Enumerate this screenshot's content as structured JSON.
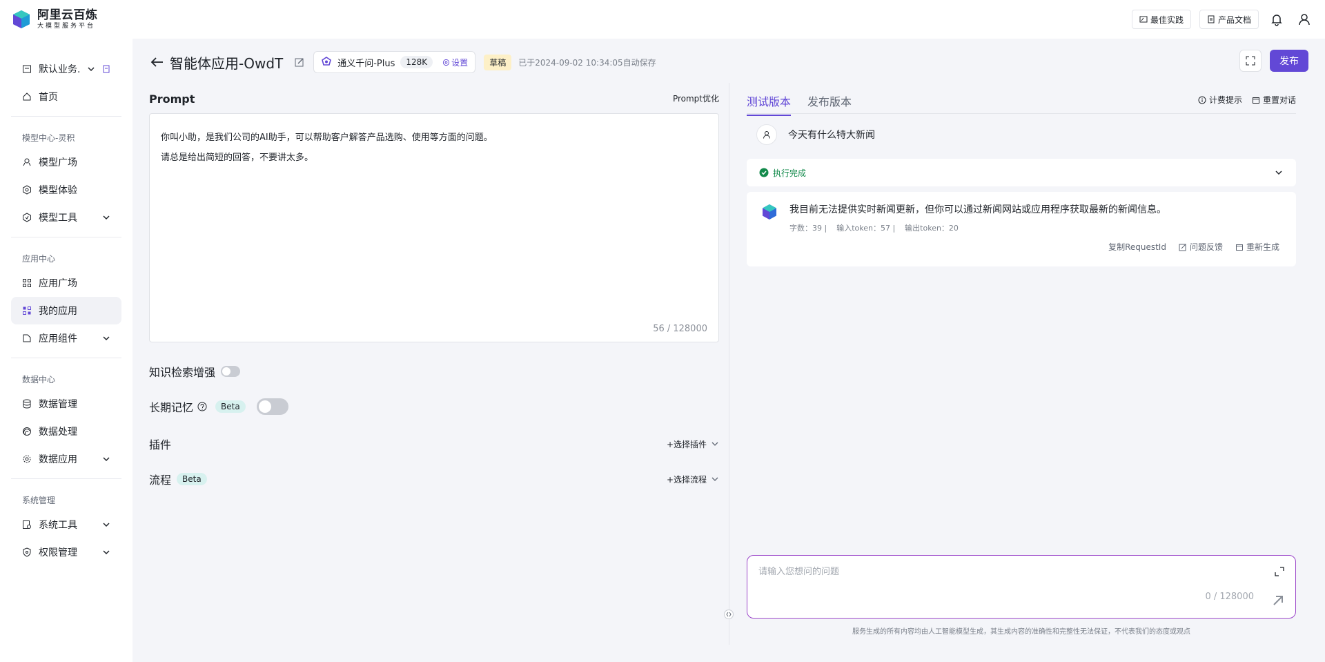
{
  "brand": {
    "title": "阿里云百炼",
    "subtitle": "大模型服务平台"
  },
  "topbar": {
    "best_practice": "最佳实践",
    "docs": "产品文档",
    "icons": [
      "bell-icon",
      "user-icon"
    ]
  },
  "sidebar": {
    "workspace": "默认业务...",
    "home": "首页",
    "groups": [
      {
        "title": "模型中心-灵积",
        "items": [
          {
            "label": "模型广场"
          },
          {
            "label": "模型体验"
          },
          {
            "label": "模型工具"
          }
        ]
      },
      {
        "title": "应用中心",
        "items": [
          {
            "label": "应用广场"
          },
          {
            "label": "我的应用"
          },
          {
            "label": "应用组件"
          }
        ]
      },
      {
        "title": "数据中心",
        "items": [
          {
            "label": "数据管理"
          },
          {
            "label": "数据处理"
          },
          {
            "label": "数据应用"
          }
        ]
      },
      {
        "title": "系统管理",
        "items": [
          {
            "label": "系统工具"
          },
          {
            "label": "权限管理"
          }
        ]
      }
    ],
    "active_item": "我的应用"
  },
  "header": {
    "title": "智能体应用-OwdT",
    "model_name": "通义千问-Plus",
    "context_tag": "128K",
    "settings": "设置",
    "status": "草稿",
    "save_time": "已于2024-09-02 10:34:05自动保存",
    "publish": "发布"
  },
  "config": {
    "prompt_label": "Prompt",
    "prompt_optimize": "Prompt优化",
    "prompt_lines": [
      "你叫小助，是我们公司的AI助手，可以帮助客户解答产品选购、使用等方面的问题。",
      "请总是给出简短的回答，不要讲太多。"
    ],
    "prompt_count": "56 / 128000",
    "knowledge": "知识检索增强",
    "memory": "长期记忆",
    "beta": "Beta",
    "plugins": "插件",
    "plugins_action": "+选择插件",
    "flow": "流程",
    "flow_action": "+选择流程"
  },
  "chat": {
    "tabs": [
      "测试版本",
      "发布版本"
    ],
    "active_tab": "测试版本",
    "billing": "计费提示",
    "reset": "重置对话",
    "user_message": "今天有什么特大新闻",
    "status": "执行完成",
    "answer": "我目前无法提供实时新闻更新，但你可以通过新闻网站或应用程序获取最新的新闻信息。",
    "meta": {
      "chars": "字数：39  |",
      "input_tokens": "输入token：57  |",
      "output_tokens": "输出token：20"
    },
    "actions": {
      "copy_id": "复制RequestId",
      "feedback": "问题反馈",
      "regenerate": "重新生成"
    },
    "input_placeholder": "请输入您想问的问题",
    "input_value": "",
    "input_count": "0 / 128000",
    "disclaimer": "服务生成的所有内容均由人工智能模型生成，其生成内容的准确性和完整性无法保证，不代表我们的态度或观点"
  },
  "colors": {
    "accent": "#6248d6",
    "success": "#138a4b",
    "draft": "#fdf0c7",
    "beta": "#d7f1ef"
  }
}
